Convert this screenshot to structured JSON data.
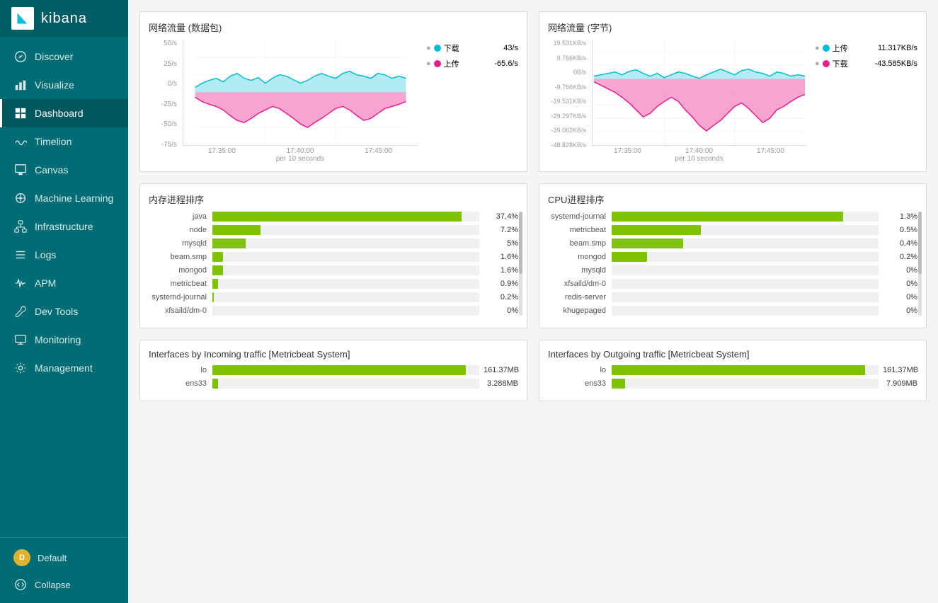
{
  "sidebar": {
    "logo": "kibana",
    "items": [
      {
        "id": "discover",
        "label": "Discover",
        "icon": "compass"
      },
      {
        "id": "visualize",
        "label": "Visualize",
        "icon": "bar-chart"
      },
      {
        "id": "dashboard",
        "label": "Dashboard",
        "icon": "grid",
        "active": true
      },
      {
        "id": "timelion",
        "label": "Timelion",
        "icon": "wave"
      },
      {
        "id": "canvas",
        "label": "Canvas",
        "icon": "paint"
      },
      {
        "id": "ml",
        "label": "Machine Learning",
        "icon": "brain"
      },
      {
        "id": "infrastructure",
        "label": "Infrastructure",
        "icon": "network"
      },
      {
        "id": "logs",
        "label": "Logs",
        "icon": "list"
      },
      {
        "id": "apm",
        "label": "APM",
        "icon": "pulse"
      },
      {
        "id": "devtools",
        "label": "Dev Tools",
        "icon": "wrench"
      },
      {
        "id": "monitoring",
        "label": "Monitoring",
        "icon": "monitor"
      },
      {
        "id": "management",
        "label": "Management",
        "icon": "gear"
      }
    ],
    "footer": {
      "user": "Default",
      "collapse": "Collapse"
    }
  },
  "panels": {
    "network_packets": {
      "title": "网络流量 (数据包)",
      "legend": {
        "download": {
          "label": "下载",
          "value": "43/s",
          "color": "#00bcd4"
        },
        "upload": {
          "label": "上传",
          "value": "-65.6/s",
          "color": "#e91e8c"
        }
      },
      "y_axis": [
        "50/s",
        "25/s",
        "0/s",
        "-25/s",
        "-50/s",
        "-75/s"
      ],
      "x_axis": [
        "17:35:00",
        "17:40:00",
        "17:45:00"
      ],
      "x_sub": "per 10 seconds"
    },
    "network_bytes": {
      "title": "网络流量 (字节)",
      "legend": {
        "upload": {
          "label": "上传",
          "value": "11.317KB/s",
          "color": "#00bcd4"
        },
        "download": {
          "label": "下载",
          "value": "-43.585KB/s",
          "color": "#e91e8c"
        }
      },
      "y_axis": [
        "19.531KB/s",
        "9.766KB/s",
        "0B/s",
        "-9.766KB/s",
        "-19.531KB/s",
        "-29.297KB/s",
        "-39.062KB/s",
        "-48.828KB/s"
      ],
      "x_axis": [
        "17:35:00",
        "17:40:00",
        "17:45:00"
      ],
      "x_sub": "per 10 seconds"
    },
    "memory_processes": {
      "title": "内存进程排序",
      "rows": [
        {
          "label": "java",
          "value": "37.4%",
          "pct": 37.4
        },
        {
          "label": "node",
          "value": "7.2%",
          "pct": 7.2
        },
        {
          "label": "mysqld",
          "value": "5%",
          "pct": 5.0
        },
        {
          "label": "beam.smp",
          "value": "1.6%",
          "pct": 1.6
        },
        {
          "label": "mongod",
          "value": "1.6%",
          "pct": 1.6
        },
        {
          "label": "metricbeat",
          "value": "0.9%",
          "pct": 0.9
        },
        {
          "label": "systemd-journal",
          "value": "0.2%",
          "pct": 0.2
        },
        {
          "label": "xfsaild/dm-0",
          "value": "0%",
          "pct": 0
        }
      ]
    },
    "cpu_processes": {
      "title": "CPU进程排序",
      "rows": [
        {
          "label": "systemd-journal",
          "value": "1.3%",
          "pct": 1.3
        },
        {
          "label": "metricbeat",
          "value": "0.5%",
          "pct": 0.5
        },
        {
          "label": "beam.smp",
          "value": "0.4%",
          "pct": 0.4
        },
        {
          "label": "mongod",
          "value": "0.2%",
          "pct": 0.2
        },
        {
          "label": "mysqld",
          "value": "0%",
          "pct": 0
        },
        {
          "label": "xfsaild/dm-0",
          "value": "0%",
          "pct": 0
        },
        {
          "label": "redis-server",
          "value": "0%",
          "pct": 0
        },
        {
          "label": "khugepaged",
          "value": "0%",
          "pct": 0
        }
      ]
    },
    "incoming_traffic": {
      "title": "Interfaces by Incoming traffic [Metricbeat System]",
      "rows": [
        {
          "label": "lo",
          "value": "161.37MB",
          "pct": 95
        },
        {
          "label": "ens33",
          "value": "3.288MB",
          "pct": 2
        }
      ]
    },
    "outgoing_traffic": {
      "title": "Interfaces by Outgoing traffic [Metricbeat System]",
      "rows": [
        {
          "label": "lo",
          "value": "161.37MB",
          "pct": 95
        },
        {
          "label": "ens33",
          "value": "7.909MB",
          "pct": 5
        }
      ]
    }
  },
  "colors": {
    "sidebar_bg": "#006d75",
    "sidebar_active": "rgba(0,0,0,0.2)",
    "bar_green": "#7ec200",
    "cyan": "#00bcd4",
    "magenta": "#e91e8c"
  }
}
